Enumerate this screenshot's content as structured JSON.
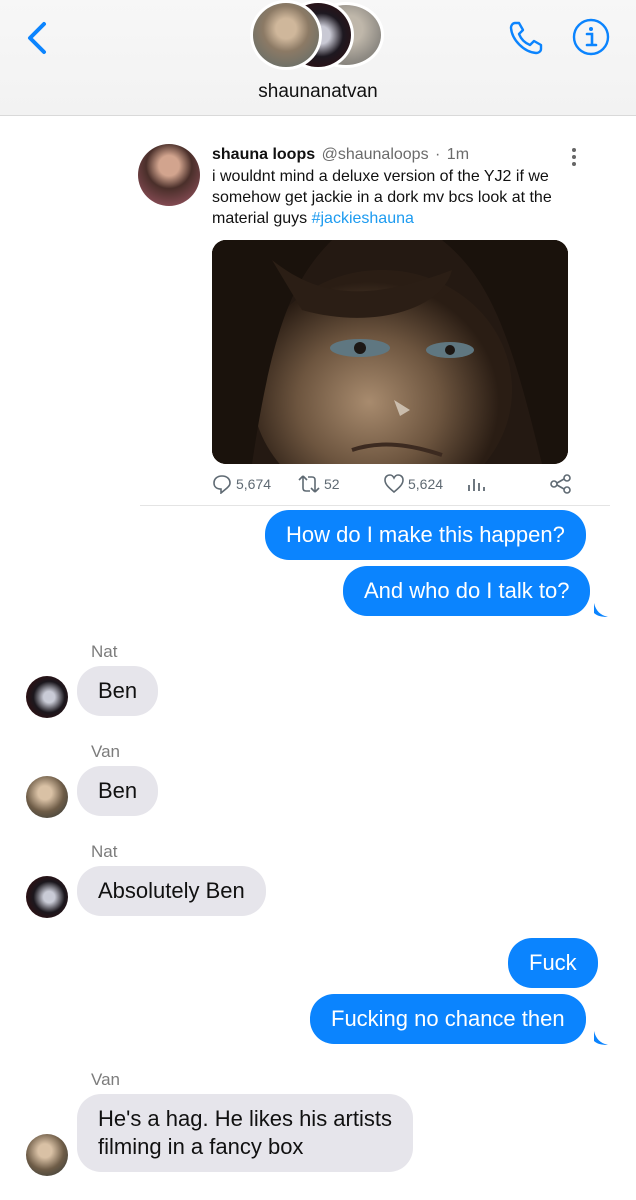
{
  "header": {
    "title": "shaunanatvan",
    "back_icon": "chevron-left-icon",
    "call_icon": "phone-icon",
    "info_icon": "info-icon",
    "accent_color": "#0b84fe"
  },
  "tweet": {
    "display_name": "shauna loops",
    "handle": "@shaunaloops",
    "separator": "·",
    "time": "1m",
    "text": "i wouldnt mind a deluxe version of the YJ2 if we somehow get jackie in a dork mv bcs look at the material guys ",
    "hashtag": "#jackieshauna",
    "replies": "5,674",
    "retweets": "52",
    "likes": "5,624",
    "hashtag_color": "#1d9bf0"
  },
  "messages": {
    "m1": "How do I make this happen?",
    "m2": "And who do I talk to?",
    "m3_sender": "Nat",
    "m3": "Ben",
    "m4_sender": "Van",
    "m4": "Ben",
    "m5_sender": "Nat",
    "m5": "Absolutely Ben",
    "m6": "Fuck",
    "m7": "Fucking no chance then",
    "m8_sender": "Van",
    "m8_line1": "He's a hag. He likes his artists",
    "m8_line2": "filming in a fancy box"
  },
  "colors": {
    "sent_bubble": "#0b84fe",
    "received_bubble": "#e6e5eb"
  }
}
